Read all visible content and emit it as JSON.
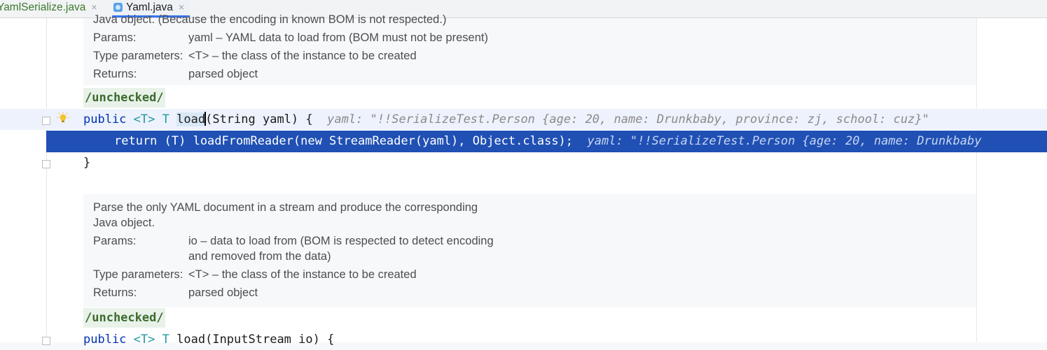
{
  "tabs": [
    {
      "label": "YamlSerialize.java",
      "close": "×"
    },
    {
      "label": "Yaml.java",
      "close": "×"
    }
  ],
  "doc1": {
    "line0": "Java object. (Because the encoding in known BOM is not respected.)",
    "params_label": "Params:",
    "params_value": "yaml – YAML data to load from (BOM must not be present)",
    "type_params_label": "Type parameters:",
    "type_params_value": "<T> – the class of the instance to be created",
    "returns_label": "Returns:",
    "returns_value": "parsed object"
  },
  "annotation": "/unchecked/",
  "method1": {
    "kw": "public",
    "generic": "<T>",
    "type": "T",
    "name": "load",
    "signature_rest": "(String yaml) {",
    "hint": "yaml: \"!!SerializeTest.Person {age: 20, name: Drunkbaby, province: zj, school: cuz}\""
  },
  "return_line": {
    "code": "return (T) loadFromReader(new StreamReader(yaml), Object.class);",
    "hint": "yaml: \"!!SerializeTest.Person {age: 20, name: Drunkbaby"
  },
  "close_brace": "}",
  "doc2": {
    "line0": "Parse the only YAML document in a stream and produce the corresponding",
    "line1": "Java object.",
    "params_label": "Params:",
    "params_value_1": "io – data to load from (BOM is respected to detect encoding",
    "params_value_2": "and removed from the data)",
    "type_params_label": "Type parameters:",
    "type_params_value": "<T> – the class of the instance to be created",
    "returns_label": "Returns:",
    "returns_value": "parsed object"
  },
  "method2": {
    "kw": "public",
    "generic": "<T>",
    "type": "T",
    "name": "load",
    "signature_rest": "(InputStream io) {"
  },
  "colors": {
    "selection": "#2050b4",
    "keyword": "#0033b3",
    "annotation": "#3d6b2e",
    "doc_bg": "#f7f8fa"
  },
  "icons": [
    "java-class-icon",
    "intention-bulb-icon",
    "fold-marker-icon"
  ]
}
